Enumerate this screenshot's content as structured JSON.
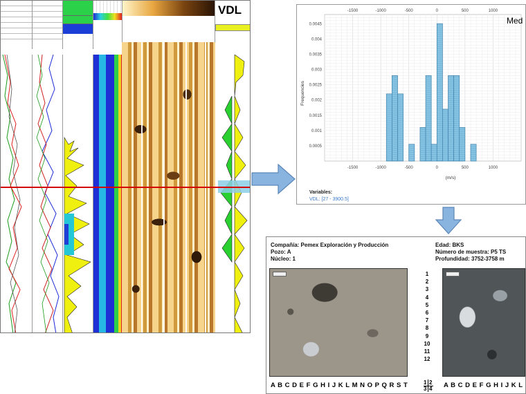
{
  "log_panel": {
    "title": "VDL",
    "depth_line_color": "#d40000"
  },
  "chart_data": {
    "type": "bar",
    "title": "",
    "corner_text": "Med",
    "xlabel": "(m/s)",
    "ylabel": "Frequencies",
    "xlim": [
      -2000,
      1500
    ],
    "ylim": [
      0,
      0.0048
    ],
    "x_ticks": [
      -1500,
      -1000,
      -500,
      0,
      500,
      1000
    ],
    "y_ticks": [
      0.0005,
      0.001,
      0.0015,
      0.002,
      0.0025,
      0.003,
      0.0035,
      0.004,
      0.0045
    ],
    "y_tick_labels": [
      "0.0005",
      "0.001",
      "0.0015",
      "0.002",
      "0.0025",
      "0.003",
      "0.0035",
      "0.004",
      "0.0045"
    ],
    "grid": true,
    "bin_width": 100,
    "bins": [
      {
        "x0": -900,
        "value": 0.0022
      },
      {
        "x0": -800,
        "value": 0.0028
      },
      {
        "x0": -700,
        "value": 0.0022
      },
      {
        "x0": -600,
        "value": 0
      },
      {
        "x0": -500,
        "value": 0.00055
      },
      {
        "x0": -400,
        "value": 0
      },
      {
        "x0": -300,
        "value": 0.0011
      },
      {
        "x0": -200,
        "value": 0.0028
      },
      {
        "x0": -100,
        "value": 0.00055
      },
      {
        "x0": 0,
        "value": 0.0045
      },
      {
        "x0": 100,
        "value": 0.0017
      },
      {
        "x0": 200,
        "value": 0.0028
      },
      {
        "x0": 300,
        "value": 0.0028
      },
      {
        "x0": 400,
        "value": 0.0011
      },
      {
        "x0": 500,
        "value": 0
      },
      {
        "x0": 600,
        "value": 0.00055
      }
    ],
    "bar_color": "#86c3e3",
    "legend": {
      "title": "Variables:",
      "entry": "VDL: [27 - 3900.5]"
    }
  },
  "thin_section": {
    "company": "Compañía:  Pemex Exploración y Producción",
    "well": "Pozo: A",
    "core": "Núcleo: 1",
    "age": "Edad: BKS",
    "sample": "Número de muestra: P5 TS",
    "depth": "Profundidad: 3752-3758 m",
    "numbers": [
      "1",
      "2",
      "3",
      "4",
      "5",
      "6",
      "7",
      "8",
      "9",
      "10",
      "11",
      "12"
    ],
    "quadrants": [
      "1",
      "2",
      "3",
      "4"
    ],
    "letters_left": "A B C D E F G H I J K L M N O P Q R S T",
    "letters_right": "A B C D E F G H I J K L"
  },
  "arrow_color": "#8ab4e0"
}
